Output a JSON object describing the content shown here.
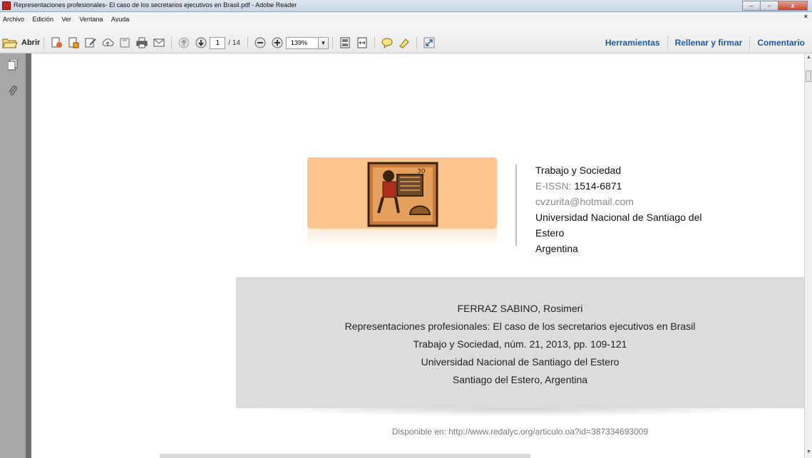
{
  "window": {
    "title": "Representaciones profesionales- El caso de los secretarios ejecutivos en Brasil.pdf - Adobe Reader",
    "controls": [
      "–",
      "▫",
      "x"
    ]
  },
  "menu": {
    "items": [
      "Archivo",
      "Edición",
      "Ver",
      "Ventana",
      "Ayuda"
    ],
    "close_doc": "×"
  },
  "toolbar": {
    "open_label": "Abrir",
    "page_current": "1",
    "page_total": "/ 14",
    "zoom": "139%",
    "tabs": [
      "Herramientas",
      "Rellenar y firmar",
      "Comentario"
    ]
  },
  "document": {
    "journal": {
      "name": "Trabajo y Sociedad",
      "issn_label": "E-ISSN:",
      "issn": "1514-6871",
      "email": "cvzurita@hotmail.com",
      "university_line1": "Universidad Nacional de Santiago del",
      "university_line2": "Estero",
      "country": "Argentina"
    },
    "citation": {
      "author": "FERRAZ SABINO, Rosimeri",
      "title": "Representaciones profesionales: El caso de los secretarios ejecutivos en Brasil",
      "source": "Trabajo y Sociedad, núm. 21, 2013, pp. 109-121",
      "institution": "Universidad Nacional de Santiago del Estero",
      "location": "Santiago del Estero, Argentina"
    },
    "available": "Disponible en: http://www.redalyc.org/articulo.oa?id=387334693009",
    "logo_number": "30"
  },
  "colors": {
    "logo_bg": "#fcc590",
    "tab_text": "#1f5a9e",
    "cite_bg": "#dcdcdc"
  }
}
